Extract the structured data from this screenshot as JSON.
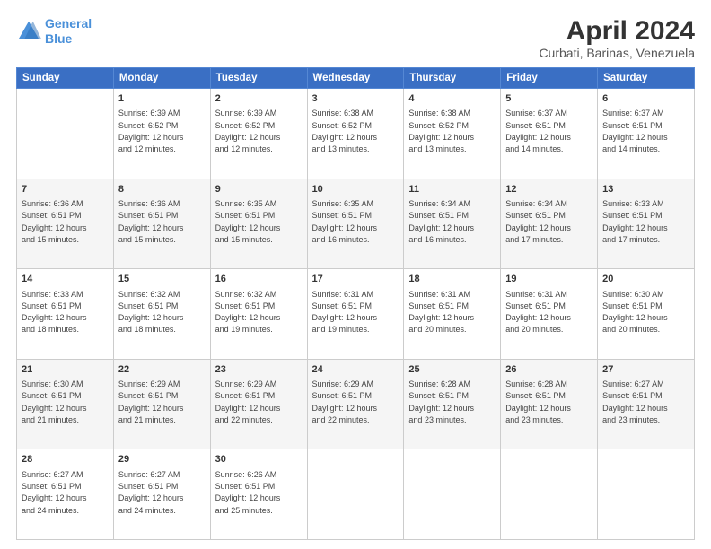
{
  "header": {
    "logo_line1": "General",
    "logo_line2": "Blue",
    "month": "April 2024",
    "location": "Curbati, Barinas, Venezuela"
  },
  "weekdays": [
    "Sunday",
    "Monday",
    "Tuesday",
    "Wednesday",
    "Thursday",
    "Friday",
    "Saturday"
  ],
  "weeks": [
    [
      {
        "day": "",
        "text": ""
      },
      {
        "day": "1",
        "text": "Sunrise: 6:39 AM\nSunset: 6:52 PM\nDaylight: 12 hours\nand 12 minutes."
      },
      {
        "day": "2",
        "text": "Sunrise: 6:39 AM\nSunset: 6:52 PM\nDaylight: 12 hours\nand 12 minutes."
      },
      {
        "day": "3",
        "text": "Sunrise: 6:38 AM\nSunset: 6:52 PM\nDaylight: 12 hours\nand 13 minutes."
      },
      {
        "day": "4",
        "text": "Sunrise: 6:38 AM\nSunset: 6:52 PM\nDaylight: 12 hours\nand 13 minutes."
      },
      {
        "day": "5",
        "text": "Sunrise: 6:37 AM\nSunset: 6:51 PM\nDaylight: 12 hours\nand 14 minutes."
      },
      {
        "day": "6",
        "text": "Sunrise: 6:37 AM\nSunset: 6:51 PM\nDaylight: 12 hours\nand 14 minutes."
      }
    ],
    [
      {
        "day": "7",
        "text": "Sunrise: 6:36 AM\nSunset: 6:51 PM\nDaylight: 12 hours\nand 15 minutes."
      },
      {
        "day": "8",
        "text": "Sunrise: 6:36 AM\nSunset: 6:51 PM\nDaylight: 12 hours\nand 15 minutes."
      },
      {
        "day": "9",
        "text": "Sunrise: 6:35 AM\nSunset: 6:51 PM\nDaylight: 12 hours\nand 15 minutes."
      },
      {
        "day": "10",
        "text": "Sunrise: 6:35 AM\nSunset: 6:51 PM\nDaylight: 12 hours\nand 16 minutes."
      },
      {
        "day": "11",
        "text": "Sunrise: 6:34 AM\nSunset: 6:51 PM\nDaylight: 12 hours\nand 16 minutes."
      },
      {
        "day": "12",
        "text": "Sunrise: 6:34 AM\nSunset: 6:51 PM\nDaylight: 12 hours\nand 17 minutes."
      },
      {
        "day": "13",
        "text": "Sunrise: 6:33 AM\nSunset: 6:51 PM\nDaylight: 12 hours\nand 17 minutes."
      }
    ],
    [
      {
        "day": "14",
        "text": "Sunrise: 6:33 AM\nSunset: 6:51 PM\nDaylight: 12 hours\nand 18 minutes."
      },
      {
        "day": "15",
        "text": "Sunrise: 6:32 AM\nSunset: 6:51 PM\nDaylight: 12 hours\nand 18 minutes."
      },
      {
        "day": "16",
        "text": "Sunrise: 6:32 AM\nSunset: 6:51 PM\nDaylight: 12 hours\nand 19 minutes."
      },
      {
        "day": "17",
        "text": "Sunrise: 6:31 AM\nSunset: 6:51 PM\nDaylight: 12 hours\nand 19 minutes."
      },
      {
        "day": "18",
        "text": "Sunrise: 6:31 AM\nSunset: 6:51 PM\nDaylight: 12 hours\nand 20 minutes."
      },
      {
        "day": "19",
        "text": "Sunrise: 6:31 AM\nSunset: 6:51 PM\nDaylight: 12 hours\nand 20 minutes."
      },
      {
        "day": "20",
        "text": "Sunrise: 6:30 AM\nSunset: 6:51 PM\nDaylight: 12 hours\nand 20 minutes."
      }
    ],
    [
      {
        "day": "21",
        "text": "Sunrise: 6:30 AM\nSunset: 6:51 PM\nDaylight: 12 hours\nand 21 minutes."
      },
      {
        "day": "22",
        "text": "Sunrise: 6:29 AM\nSunset: 6:51 PM\nDaylight: 12 hours\nand 21 minutes."
      },
      {
        "day": "23",
        "text": "Sunrise: 6:29 AM\nSunset: 6:51 PM\nDaylight: 12 hours\nand 22 minutes."
      },
      {
        "day": "24",
        "text": "Sunrise: 6:29 AM\nSunset: 6:51 PM\nDaylight: 12 hours\nand 22 minutes."
      },
      {
        "day": "25",
        "text": "Sunrise: 6:28 AM\nSunset: 6:51 PM\nDaylight: 12 hours\nand 23 minutes."
      },
      {
        "day": "26",
        "text": "Sunrise: 6:28 AM\nSunset: 6:51 PM\nDaylight: 12 hours\nand 23 minutes."
      },
      {
        "day": "27",
        "text": "Sunrise: 6:27 AM\nSunset: 6:51 PM\nDaylight: 12 hours\nand 23 minutes."
      }
    ],
    [
      {
        "day": "28",
        "text": "Sunrise: 6:27 AM\nSunset: 6:51 PM\nDaylight: 12 hours\nand 24 minutes."
      },
      {
        "day": "29",
        "text": "Sunrise: 6:27 AM\nSunset: 6:51 PM\nDaylight: 12 hours\nand 24 minutes."
      },
      {
        "day": "30",
        "text": "Sunrise: 6:26 AM\nSunset: 6:51 PM\nDaylight: 12 hours\nand 25 minutes."
      },
      {
        "day": "",
        "text": ""
      },
      {
        "day": "",
        "text": ""
      },
      {
        "day": "",
        "text": ""
      },
      {
        "day": "",
        "text": ""
      }
    ]
  ]
}
